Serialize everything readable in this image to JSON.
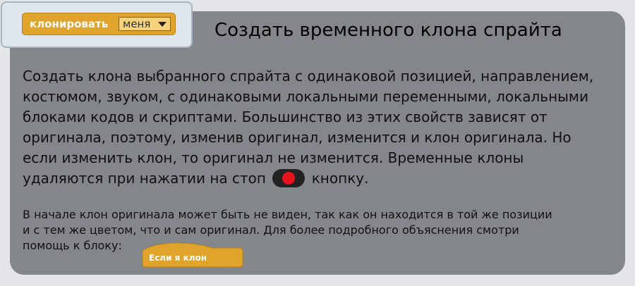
{
  "block_card": {
    "block_label": "клонировать",
    "dropdown_value": "меня"
  },
  "title": "Создать временного клона спрайта",
  "paragraph1": {
    "lines": [
      "Создать клона выбранного спрайта с одинаковой позицией,  направлением,",
      "костюмом, звуком, с одинаковыми локальными переменными, локальными",
      "блоками кодов и скриптами. Большинство из этих свойств зависят от",
      "оригинала, поэтому, изменив оригинал, изменится и клон оригинала. Но",
      "если изменить клон, то оригинал не изменится. Временные клоны"
    ],
    "last_before": "удаляются при нажатии на стоп",
    "last_after": "кнопку."
  },
  "paragraph2": {
    "lines": [
      "В начале клон оригинала может быть не виден, так как он находится в той же позиции",
      "и с тем же цветом, что и сам оригинал. Для более подробного объяснения смотри",
      "помощь к блоку:"
    ]
  },
  "hat_block": {
    "label": "Если я клон"
  },
  "colors": {
    "panel": "#83868a",
    "block_orange": "#e0a32b",
    "stop_red": "#e8141b"
  }
}
